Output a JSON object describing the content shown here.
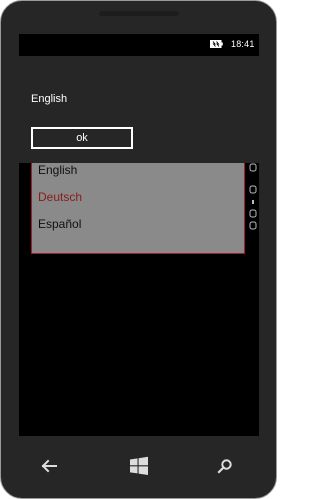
{
  "status_bar": {
    "time": "18:41",
    "battery_icon": "battery-icon"
  },
  "dialog": {
    "message": "English",
    "ok_label": "ok"
  },
  "language_list": {
    "items": [
      {
        "label": "English",
        "selected": false
      },
      {
        "label": "Deutsch",
        "selected": true
      },
      {
        "label": "Español",
        "selected": false
      }
    ],
    "selection_color": "#8b1a1a"
  },
  "navigation": {
    "back_icon": "back-arrow-icon",
    "start_icon": "windows-start-icon",
    "search_icon": "search-icon"
  }
}
